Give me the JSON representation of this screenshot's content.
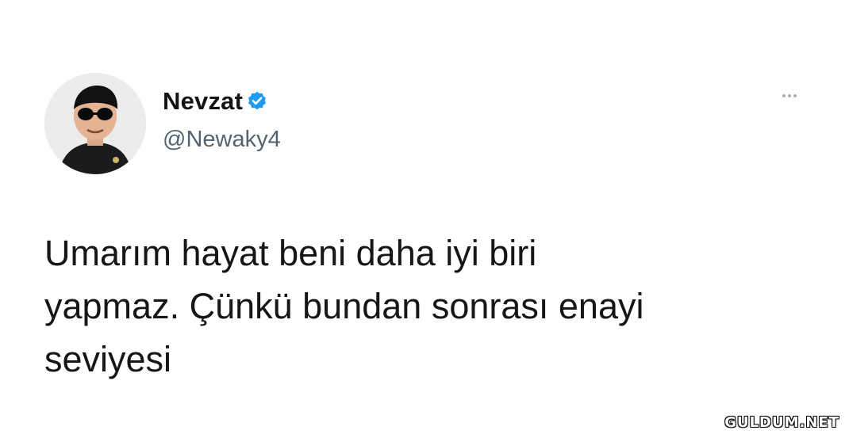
{
  "tweet": {
    "author": {
      "display_name": "Nevzat",
      "handle": "@Newaky4",
      "verified": true,
      "avatar_icon": "user-avatar-with-sunglasses"
    },
    "text_lines": [
      "Umarım hayat beni daha iyi biri",
      "yapmaz. Çünkü bundan sonrası enayi",
      "seviyesi"
    ],
    "more_icon": "more-options-icon"
  },
  "watermark": {
    "text": "GULDUM.NET"
  },
  "colors": {
    "background": "#ffffff",
    "text": "#161616",
    "handle": "#536471",
    "verified_badge": "#1d9bf0"
  }
}
